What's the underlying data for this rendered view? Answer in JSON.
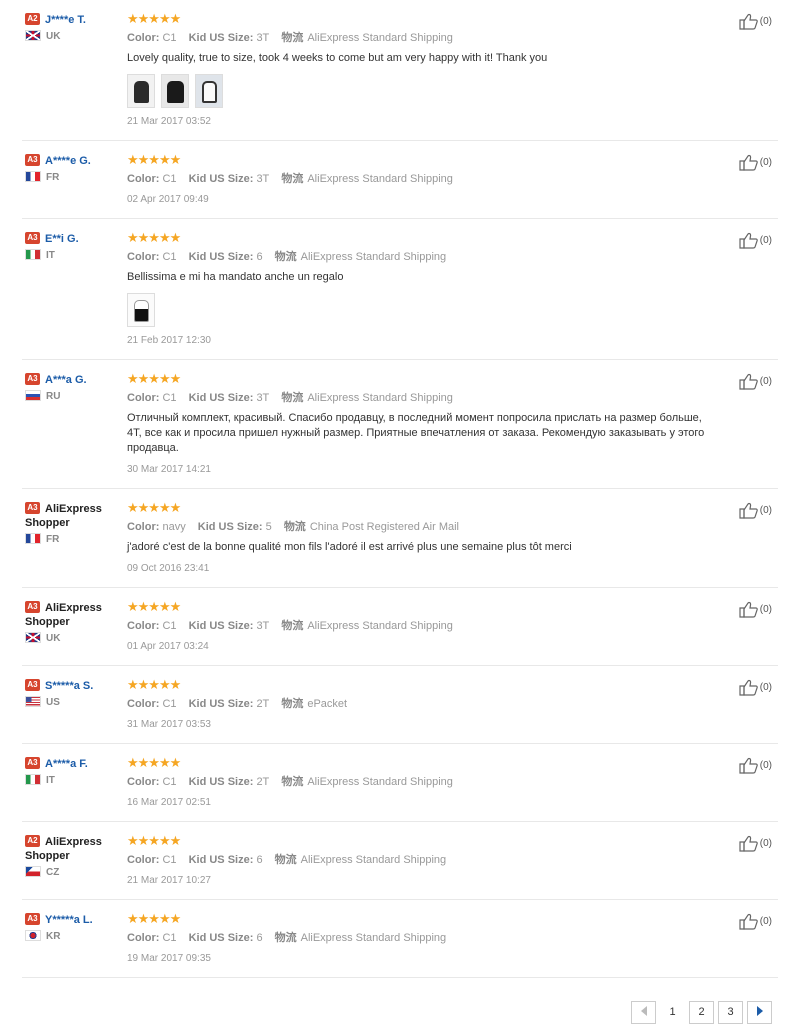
{
  "labels": {
    "color": "Color:",
    "size": "Kid US Size:",
    "logistics": "物流"
  },
  "reviews": [
    {
      "level": "A2",
      "name": "J****e T.",
      "shopper": false,
      "country": "UK",
      "flag": "uk",
      "color": "C1",
      "size": "3T",
      "shipping": "AliExpress Standard Shipping",
      "text": "Lovely quality, true to size, took 4 weeks to come but am very happy with it! Thank you",
      "photos": 3,
      "date": "21 Mar 2017 03:52",
      "likes": "(0)"
    },
    {
      "level": "A3",
      "name": "A****e G.",
      "shopper": false,
      "country": "FR",
      "flag": "fr",
      "color": "C1",
      "size": "3T",
      "shipping": "AliExpress Standard Shipping",
      "text": "",
      "photos": 0,
      "date": "02 Apr 2017 09:49",
      "likes": "(0)"
    },
    {
      "level": "A3",
      "name": "E**i G.",
      "shopper": false,
      "country": "IT",
      "flag": "it",
      "color": "C1",
      "size": "6",
      "shipping": "AliExpress Standard Shipping",
      "text": "Bellissima e mi ha mandato anche un regalo",
      "photos": 1,
      "date": "21 Feb 2017 12:30",
      "likes": "(0)"
    },
    {
      "level": "A3",
      "name": "A***a G.",
      "shopper": false,
      "country": "RU",
      "flag": "ru",
      "color": "C1",
      "size": "3T",
      "shipping": "AliExpress Standard Shipping",
      "text": "Отличный комплект, красивый. Спасибо продавцу, в последний момент попросила прислать на размер больше, 4Т, все как и просила пришел нужный размер. Приятные впечатления от заказа. Рекомендую заказывать у этого продавца.",
      "photos": 0,
      "date": "30 Mar 2017 14:21",
      "likes": "(0)"
    },
    {
      "level": "A3",
      "name": "AliExpress Shopper",
      "shopper": true,
      "country": "FR",
      "flag": "fr",
      "color": "navy",
      "size": "5",
      "shipping": "China Post Registered Air Mail",
      "text": "j'adoré c'est de la bonne qualité mon fils l'adoré il est arrivé plus une semaine plus tôt merci",
      "photos": 0,
      "date": "09 Oct 2016 23:41",
      "likes": "(0)"
    },
    {
      "level": "A3",
      "name": "AliExpress Shopper",
      "shopper": true,
      "country": "UK",
      "flag": "uk",
      "color": "C1",
      "size": "3T",
      "shipping": "AliExpress Standard Shipping",
      "text": "",
      "photos": 0,
      "date": "01 Apr 2017 03:24",
      "likes": "(0)"
    },
    {
      "level": "A3",
      "name": "S*****a S.",
      "shopper": false,
      "country": "US",
      "flag": "us",
      "color": "C1",
      "size": "2T",
      "shipping": "ePacket",
      "text": "",
      "photos": 0,
      "date": "31 Mar 2017 03:53",
      "likes": "(0)"
    },
    {
      "level": "A3",
      "name": "A****a F.",
      "shopper": false,
      "country": "IT",
      "flag": "it",
      "color": "C1",
      "size": "2T",
      "shipping": "AliExpress Standard Shipping",
      "text": "",
      "photos": 0,
      "date": "16 Mar 2017 02:51",
      "likes": "(0)"
    },
    {
      "level": "A2",
      "name": "AliExpress Shopper",
      "shopper": true,
      "country": "CZ",
      "flag": "cz",
      "color": "C1",
      "size": "6",
      "shipping": "AliExpress Standard Shipping",
      "text": "",
      "photos": 0,
      "date": "21 Mar 2017 10:27",
      "likes": "(0)"
    },
    {
      "level": "A3",
      "name": "Y*****a L.",
      "shopper": false,
      "country": "KR",
      "flag": "kr",
      "color": "C1",
      "size": "6",
      "shipping": "AliExpress Standard Shipping",
      "text": "",
      "photos": 0,
      "date": "19 Mar 2017 09:35",
      "likes": "(0)"
    }
  ],
  "stars": "★★★★★",
  "pagination": {
    "pages": [
      "1",
      "2",
      "3"
    ],
    "current": "1"
  },
  "icons": {
    "like": "thumbs-up-icon",
    "prev": "chevron-left-icon",
    "next": "chevron-right-icon"
  },
  "colors": {
    "star": "#f5a623",
    "level_badge": "#d6452e",
    "username": "#1c5ca8"
  }
}
